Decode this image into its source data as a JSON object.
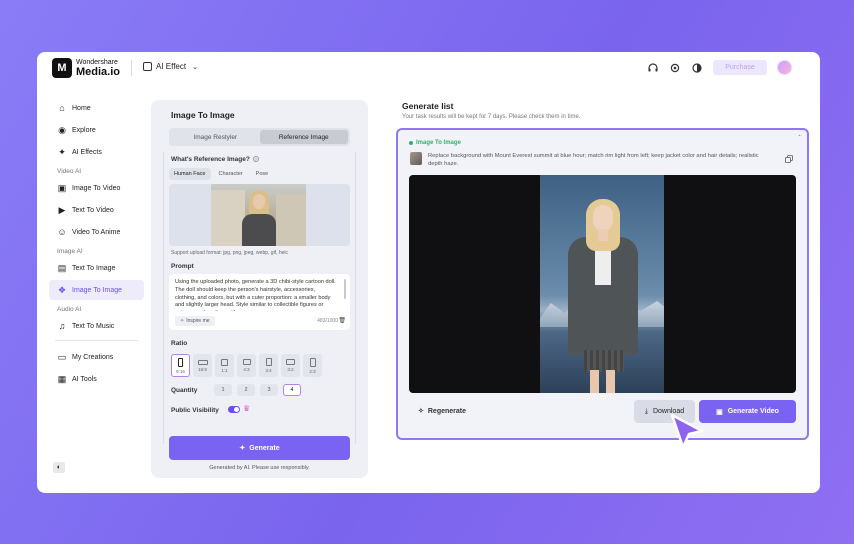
{
  "header": {
    "logo_small": "Wondershare",
    "logo_big": "Media.io",
    "effect_menu": "AI Effect",
    "purchase": "Purchase",
    "icons": [
      "headset-icon",
      "gear-icon",
      "theme-icon"
    ]
  },
  "sidebar": {
    "items_top": [
      {
        "label": "Home",
        "icon": "home-icon"
      },
      {
        "label": "Explore",
        "icon": "compass-icon"
      },
      {
        "label": "AI Effects",
        "icon": "sparkle-icon"
      }
    ],
    "video_ai_title": "Video AI",
    "video_ai": [
      {
        "label": "Image To Video",
        "icon": "image-video-icon"
      },
      {
        "label": "Text To Video",
        "icon": "text-video-icon"
      },
      {
        "label": "Video To Anime",
        "icon": "anime-icon"
      }
    ],
    "image_ai_title": "Image AI",
    "image_ai": [
      {
        "label": "Text To Image",
        "icon": "text-image-icon"
      },
      {
        "label": "Image To Image",
        "icon": "image-image-icon"
      }
    ],
    "audio_ai_title": "Audio AI",
    "audio_ai": [
      {
        "label": "Text To Music",
        "icon": "music-icon"
      }
    ],
    "bottom": [
      {
        "label": "My Creations",
        "icon": "folder-icon"
      },
      {
        "label": "AI Tools",
        "icon": "grid-icon"
      }
    ]
  },
  "panel": {
    "title": "Image To Image",
    "tabs": [
      "Image Restyler",
      "Reference Image"
    ],
    "ref_label": "What's Reference Image?",
    "subtabs": [
      "Human Face",
      "Character",
      "Pose"
    ],
    "support": "Support upload format: jpg, png, jpeg, webp, gif, heic",
    "prompt_label": "Prompt",
    "prompt_text": "Using the uploaded photo, generate a 3D chibi-style cartoon doll. The doll should keep the person's hairstyle, accessories, clothing, and colors, but with a cuter proportion: a smaller body and slightly larger head. Style similar to collectible figures or anime merchandise, with a",
    "inspire": "Inspire me",
    "count": "483/1000",
    "ratio_label": "Ratio",
    "ratios": [
      "9:16",
      "16:9",
      "1:1",
      "4:3",
      "3:4",
      "3:2",
      "2:3"
    ],
    "quantity_label": "Quantity",
    "quantities": [
      "1",
      "2",
      "3",
      "4"
    ],
    "visibility_label": "Public Visibility",
    "generate": "Generate",
    "note": "Generated by AI. Please use responsibly."
  },
  "results": {
    "title": "Generate list",
    "subtitle": "Your task results will be kept for 7 days. Please check them in time.",
    "tag": "Image To Image",
    "description": "Replace background with Mount Everest summit at blue hour; match rim light from left; keep jacket color and hair details; realistic depth haze.",
    "regenerate": "Regenerate",
    "download": "Download",
    "generate_video": "Generate Video"
  },
  "colors": {
    "accent": "#7a63f3",
    "highlight": "#8f78f0",
    "success": "#2fb36b"
  }
}
